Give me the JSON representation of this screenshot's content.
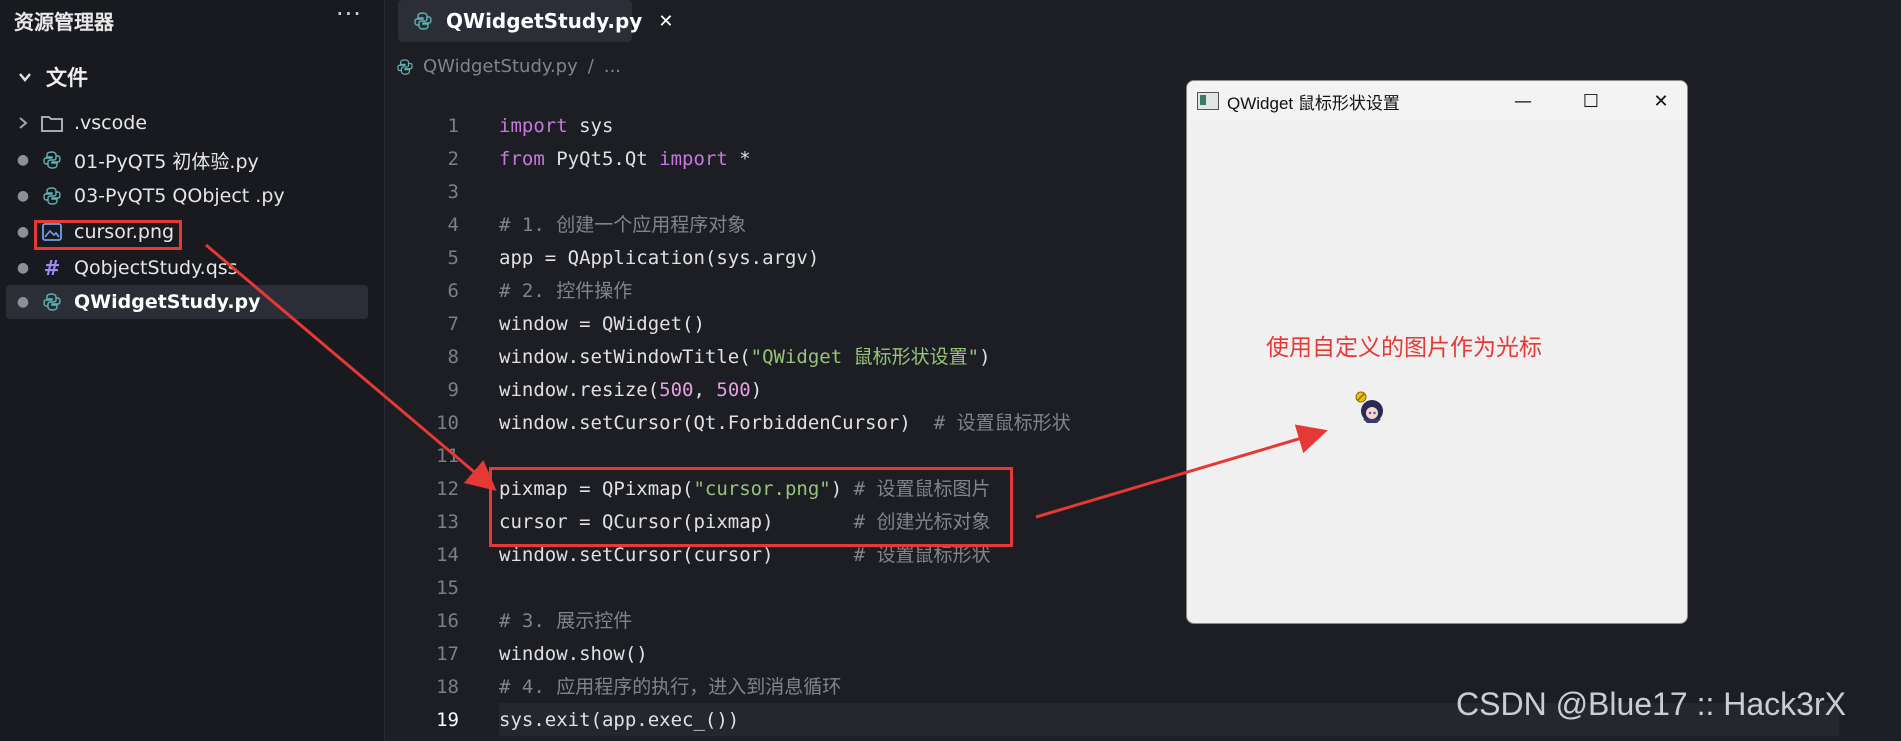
{
  "sidebar": {
    "title": "资源管理器",
    "more": "···",
    "section": "文件",
    "items": [
      {
        "label": ".vscode",
        "icon": "folder-icon"
      },
      {
        "label": "01-PyQT5 初体验.py",
        "icon": "python-file-icon"
      },
      {
        "label": "03-PyQT5 QObject .py",
        "icon": "python-file-icon"
      },
      {
        "label": "cursor.png",
        "icon": "image-file-icon"
      },
      {
        "label": "QobjectStudy.qss",
        "icon": "hash-icon"
      },
      {
        "label": "QWidgetStudy.py",
        "icon": "python-file-icon"
      }
    ]
  },
  "editor": {
    "tab": {
      "label": "QWidgetStudy.py",
      "close": "✕"
    },
    "breadcrumb": {
      "file": "QWidgetStudy.py",
      "sep": "/",
      "rest": "..."
    },
    "line_numbers": [
      "1",
      "2",
      "3",
      "4",
      "5",
      "6",
      "7",
      "8",
      "9",
      "10",
      "11",
      "12",
      "13",
      "14",
      "15",
      "16",
      "17",
      "18",
      "19"
    ],
    "current_line": "19",
    "code": {
      "l1a": "import",
      "l1b": " sys",
      "l2a": "from",
      "l2b": " PyQt5.Qt ",
      "l2c": "import",
      "l2d": " *",
      "l4": "# 1. 创建一个应用程序对象",
      "l5": "app = QApplication(sys.argv)",
      "l6": "# 2. 控件操作",
      "l7": "window = QWidget()",
      "l8a": "window.setWindowTitle(",
      "l8b": "\"QWidget 鼠标形状设置\"",
      "l8c": ")",
      "l9a": "window.resize(",
      "l9b": "500",
      "l9c": ", ",
      "l9d": "500",
      "l9e": ")",
      "l10a": "window.setCursor(Qt.ForbiddenCursor)  ",
      "l10b": "# 设置鼠标形状",
      "l12a": "pixmap = QPixmap(",
      "l12b": "\"cursor.png\"",
      "l12c": ") ",
      "l12d": "# 设置鼠标图片",
      "l13a": "cursor = QCursor(pixmap)       ",
      "l13b": "# 创建光标对象",
      "l14a": "window.setCursor(cursor)       ",
      "l14b": "# 设置鼠标形状",
      "l16": "# 3. 展示控件",
      "l17": "window.show()",
      "l18": "# 4. 应用程序的执行，进入到消息循环",
      "l19": "sys.exit(app.exec_())"
    }
  },
  "qt_window": {
    "title": "QWidget 鼠标形状设置",
    "minimize": "—",
    "maximize": "☐",
    "close": "✕"
  },
  "annotation": "使用自定义的图片作为光标",
  "watermark": "CSDN @Blue17 :: Hack3rX",
  "colors": {
    "highlight": "#e53935",
    "keyword": "#c678dd",
    "string": "#98c379",
    "number": "#e5a0e0",
    "comment": "#7f848e"
  }
}
